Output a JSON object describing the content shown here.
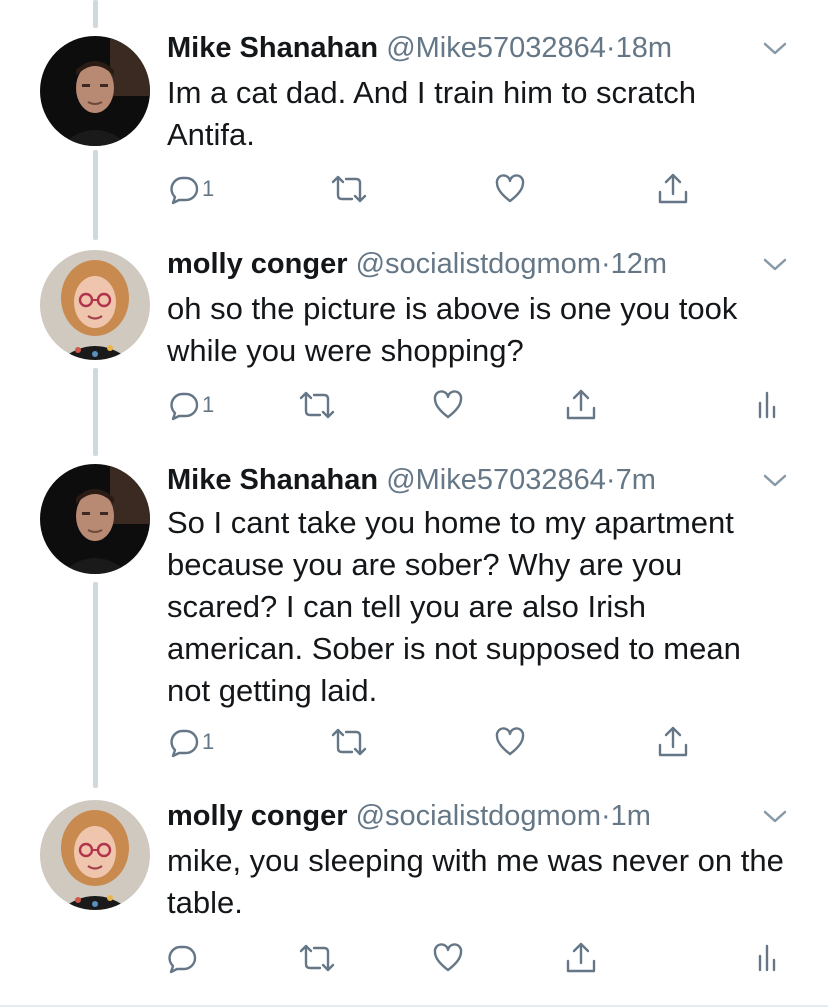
{
  "tweets": [
    {
      "name": "Mike Shanahan",
      "handle": "@Mike57032864",
      "separator": "·",
      "time": "18m",
      "text": "Im a cat dad. And I train him to scratch Antifa.",
      "reply_count": "1",
      "avatar": "man-avatar",
      "has_analytics": false
    },
    {
      "name": "molly conger",
      "handle": "@socialistdogmom",
      "separator": "·",
      "time": "12m",
      "text": "oh so the picture is above is one you took while you were shopping?",
      "reply_count": "1",
      "avatar": "woman-avatar",
      "has_analytics": true
    },
    {
      "name": "Mike Shanahan",
      "handle": "@Mike57032864",
      "separator": "·",
      "time": "7m",
      "text": "So I cant take you home to my apartment because you are sober? Why are you scared? I can tell you are also Irish american. Sober is not supposed to mean not getting laid.",
      "reply_count": "1",
      "avatar": "man-avatar",
      "has_analytics": false
    },
    {
      "name": "molly conger",
      "handle": "@socialistdogmom",
      "separator": "·",
      "time": "1m",
      "text": "mike, you sleeping with me was never on the table.",
      "reply_count": "",
      "avatar": "woman-avatar",
      "has_analytics": true
    }
  ],
  "colors": {
    "text": "#14171a",
    "secondary": "#657786",
    "thread_line": "#cfd9de"
  }
}
